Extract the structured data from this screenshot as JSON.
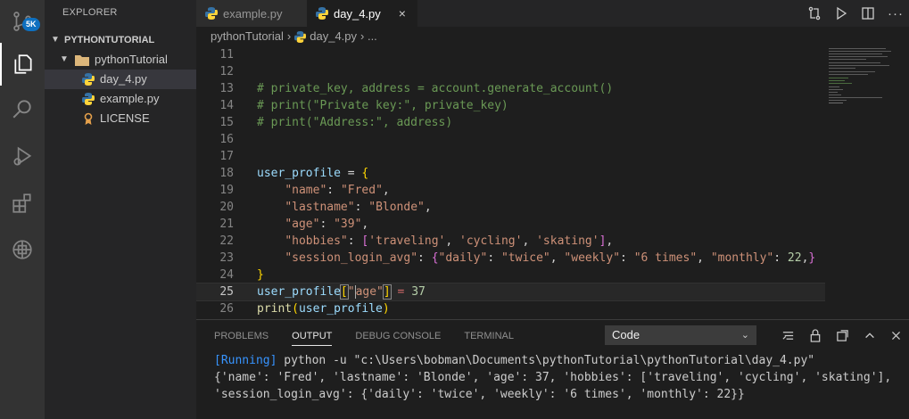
{
  "activity_bar": {
    "badge": "5K",
    "items": [
      "source-control",
      "explorer",
      "search",
      "run-debug",
      "extensions",
      "remote-explorer"
    ]
  },
  "sidebar": {
    "title": "EXPLORER",
    "section": "PYTHONTUTORIAL",
    "folder": "pythonTutorial",
    "files": [
      {
        "name": "day_4.py",
        "icon": "python-icon",
        "selected": true
      },
      {
        "name": "example.py",
        "icon": "python-icon",
        "selected": false
      },
      {
        "name": "LICENSE",
        "icon": "license-icon",
        "selected": false
      }
    ]
  },
  "tabs": [
    {
      "label": "example.py",
      "active": false
    },
    {
      "label": "day_4.py",
      "active": true,
      "close": "×"
    }
  ],
  "breadcrumb": {
    "folder": "pythonTutorial",
    "sep": "›",
    "file": "day_4.py",
    "more": "› ..."
  },
  "editor": {
    "line_numbers": [
      "11",
      "12",
      "13",
      "14",
      "15",
      "16",
      "17",
      "18",
      "19",
      "20",
      "21",
      "22",
      "23",
      "24",
      "25",
      "26"
    ],
    "current_line": "25"
  },
  "panel": {
    "tabs": [
      "PROBLEMS",
      "OUTPUT",
      "DEBUG CONSOLE",
      "TERMINAL"
    ],
    "active_tab": "OUTPUT",
    "select_value": "Code",
    "output": {
      "running_tag": "[Running]",
      "command": " python -u \"c:\\Users\\bobman\\Documents\\pythonTutorial\\pythonTutorial\\day_4.py\"",
      "line1": "{'name': 'Fred', 'lastname': 'Blonde', 'age': 37, 'hobbies': ['traveling', 'cycling', 'skating'],",
      "line2": "'session_login_avg': {'daily': 'twice', 'weekly': '6 times', 'monthly': 22}}"
    }
  },
  "colors": {
    "accent": "#0e70c0",
    "comment": "#6a9955",
    "string": "#ce9178",
    "variable": "#9cdcfe",
    "function": "#dcdcaa",
    "number": "#b5cea8"
  }
}
